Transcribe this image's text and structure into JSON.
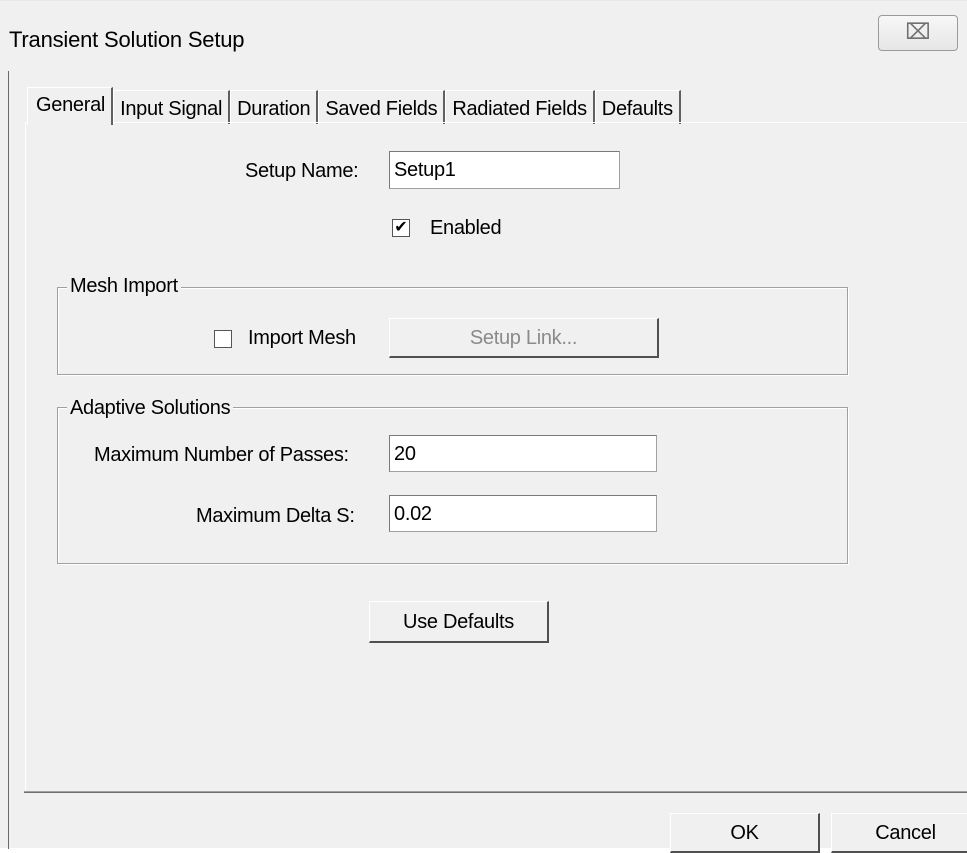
{
  "window": {
    "title": "Transient Solution Setup",
    "close_glyph": "⌧"
  },
  "tabs": [
    {
      "label": "General",
      "active": true
    },
    {
      "label": "Input Signal",
      "active": false
    },
    {
      "label": "Duration",
      "active": false
    },
    {
      "label": "Saved Fields",
      "active": false
    },
    {
      "label": "Radiated Fields",
      "active": false
    },
    {
      "label": "Defaults",
      "active": false
    }
  ],
  "general": {
    "setup_name_label": "Setup Name:",
    "setup_name_value": "Setup1",
    "enabled_label": "Enabled",
    "enabled_checked": true,
    "enabled_mark": "✔"
  },
  "mesh_import": {
    "title": "Mesh Import",
    "import_mesh_label": "Import Mesh",
    "import_mesh_checked": false,
    "setup_link_label": "Setup Link..."
  },
  "adaptive": {
    "title": "Adaptive Solutions",
    "max_passes_label": "Maximum Number of Passes:",
    "max_passes_value": "20",
    "max_delta_s_label": "Maximum Delta S:",
    "max_delta_s_value": "0.02"
  },
  "use_defaults_label": "Use Defaults",
  "footer": {
    "ok_label": "OK",
    "cancel_label": "Cancel"
  }
}
